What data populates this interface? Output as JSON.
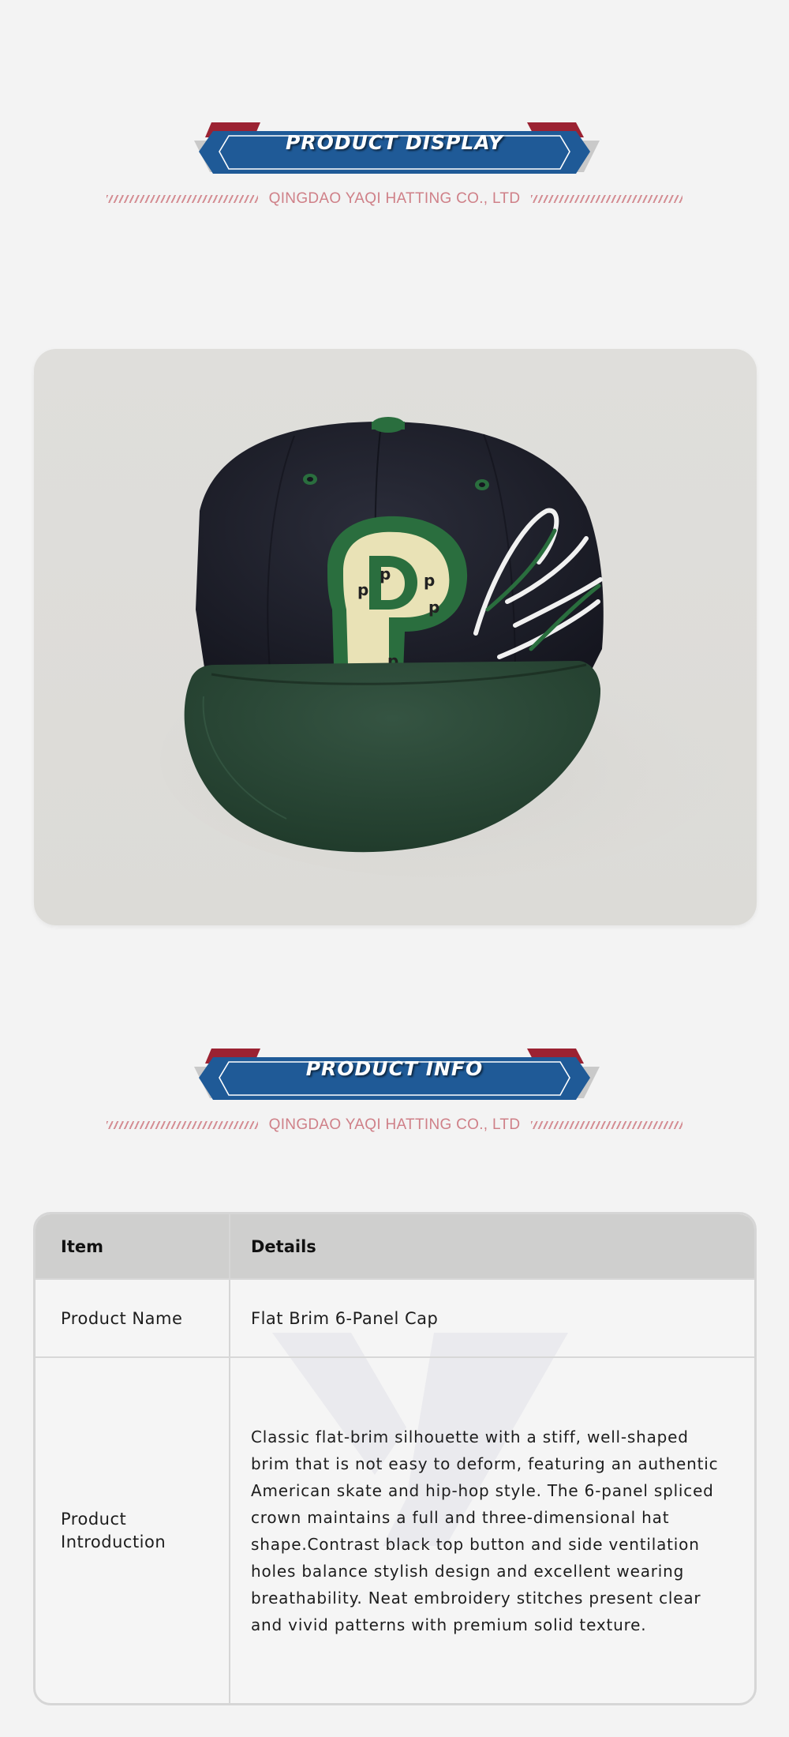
{
  "sections": {
    "display": {
      "title": "PRODUCT DISPLAY",
      "company": "QINGDAO YAQI HATTING CO., LTD"
    },
    "info": {
      "title": "PRODUCT INFO",
      "company": "QINGDAO YAQI HATTING CO., LTD"
    }
  },
  "product_image": {
    "subject": "flat-brim snapback cap",
    "crown_color": "#1e1f2a",
    "brim_color": "#2a4634",
    "patch_color": "#e9e2b6",
    "embroidery_color": "#2a6e3e"
  },
  "table": {
    "headers": {
      "item": "Item",
      "details": "Details"
    },
    "rows": [
      {
        "item": "Product Name",
        "details": "Flat Brim 6-Panel Cap"
      },
      {
        "item": "Product Introduction",
        "details": "Classic flat-brim silhouette with a stiff, well-shaped brim that is not easy to deform, featuring an authentic American skate and hip-hop style. The 6-panel spliced crown maintains a full and three-dimensional hat shape.Contrast black top button and side ventilation holes balance stylish design and excellent wearing breathability. Neat embroidery stitches present clear and vivid patterns with premium solid texture."
      }
    ]
  },
  "colors": {
    "banner_blue": "#1f5a97",
    "banner_red": "#9b2232",
    "banner_gray": "#c9c9c9",
    "company_text": "#cf8088",
    "page_bg": "#f3f3f3"
  }
}
